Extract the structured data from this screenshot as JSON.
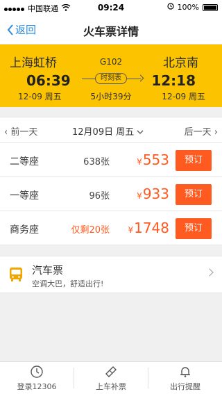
{
  "status_bar": {
    "carrier": "中国联通",
    "time": "09:24",
    "battery": "100%"
  },
  "nav": {
    "back_label": "返回",
    "title": "火车票详情"
  },
  "train": {
    "number": "G102",
    "schedule_label": "时刻表",
    "duration": "5小时39分",
    "departure": {
      "station": "上海虹桥",
      "time": "06:39",
      "date": "12-09 周五"
    },
    "arrival": {
      "station": "北京南",
      "time": "12:18",
      "date": "12-09 周五"
    }
  },
  "date_bar": {
    "prev": "前一天",
    "current": "12月09日 周五",
    "next": "后一天"
  },
  "seats": [
    {
      "name": "二等座",
      "count": "638张",
      "currency": "¥",
      "price": "553",
      "button": "预订"
    },
    {
      "name": "一等座",
      "count": "96张",
      "currency": "¥",
      "price": "933",
      "button": "预订"
    },
    {
      "name": "商务座",
      "count": "仅剩20张",
      "currency": "¥",
      "price": "1748",
      "button": "预订"
    }
  ],
  "bus": {
    "title": "汽车票",
    "subtitle": "空调大巴，舒适出行!"
  },
  "tabbar": {
    "tab1": "登录12306",
    "tab2": "上车补票",
    "tab3": "出行提醒"
  },
  "colors": {
    "accent": "#fcc300",
    "price": "#ff5a1f",
    "link": "#2a8cde"
  }
}
